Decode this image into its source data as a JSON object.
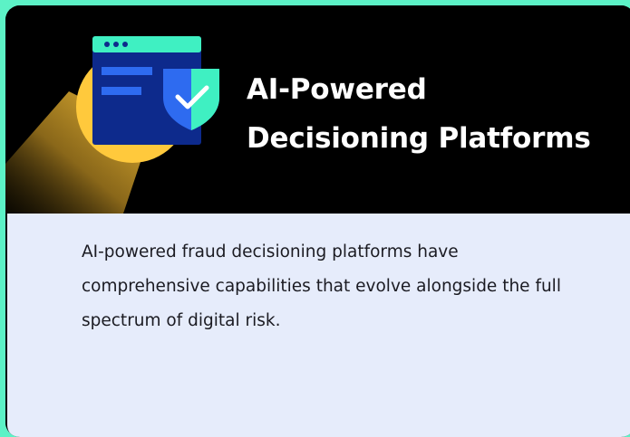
{
  "card": {
    "title": "AI-Powered Decisioning Platforms",
    "description": "AI-powered fraud decisioning platforms have comprehensive capabilities that evolve alongside the full spectrum of digital risk."
  },
  "illustration": {
    "icon": "browser-window-shield-check-icon",
    "colors": {
      "teal": "#3ff0c2",
      "navy": "#0d2a8c",
      "blue": "#2e6bf0",
      "yellow": "#ffc93c",
      "white": "#ffffff"
    }
  },
  "colors": {
    "background": "#5cf2c6",
    "header": "#000000",
    "body": "#e6ecfb",
    "title": "#ffffff",
    "text": "#1b1b22"
  }
}
